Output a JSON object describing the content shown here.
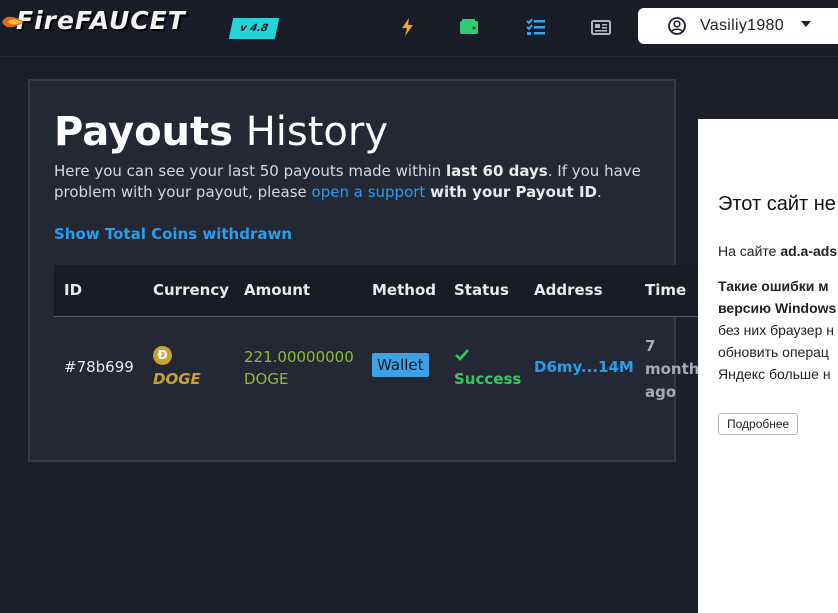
{
  "header": {
    "logo_prefix": "Fire",
    "logo_main": "FAUCET",
    "version": "v 4.8",
    "nav_icons": [
      "lightning-icon",
      "wallet-icon",
      "tasks-icon",
      "news-icon"
    ],
    "nav_colors": {
      "lightning": "#f5a623",
      "wallet": "#2ecc71",
      "tasks": "#3ba2e6",
      "news": "#b0b4bd"
    },
    "username": "Vasiliy1980"
  },
  "page": {
    "title_bold": "Payouts",
    "title_light": "History",
    "desc_part1": "Here you can see your last 50 payouts made within ",
    "desc_bold1": "last 60 days",
    "desc_part2": ". If you have problem with your payout, please ",
    "desc_link": "open a support",
    "desc_bold2": "with your Payout ID",
    "desc_end": ".",
    "show_total_label": "Show Total Coins withdrawn"
  },
  "table": {
    "headers": [
      "ID",
      "Currency",
      "Amount",
      "Method",
      "Status",
      "Address",
      "Time"
    ],
    "rows": [
      {
        "id": "#78b699",
        "currency_symbol": "Ð",
        "currency": "DOGE",
        "amount_value": "221.00000000",
        "amount_unit": "DOGE",
        "method": "Wallet",
        "status": "Success",
        "address": "D6my...14M",
        "time_1": "7",
        "time_2": "months",
        "time_3": "ago"
      }
    ]
  },
  "ad": {
    "title": "Этот сайт не",
    "line1_prefix": "На сайте ",
    "line1_bold": "ad.a-ads",
    "line2": "Такие ошибки м",
    "line3": "версию Windows",
    "line4": "без них браузер н",
    "line5": "обновить операц",
    "line6": "Яндекс больше н",
    "more_button": "Подробнее"
  },
  "colors": {
    "accent": "#2a9dea",
    "success": "#37c760",
    "doge": "#c9a234",
    "amount": "#8cbc34",
    "version_badge": "#22d3d8"
  }
}
